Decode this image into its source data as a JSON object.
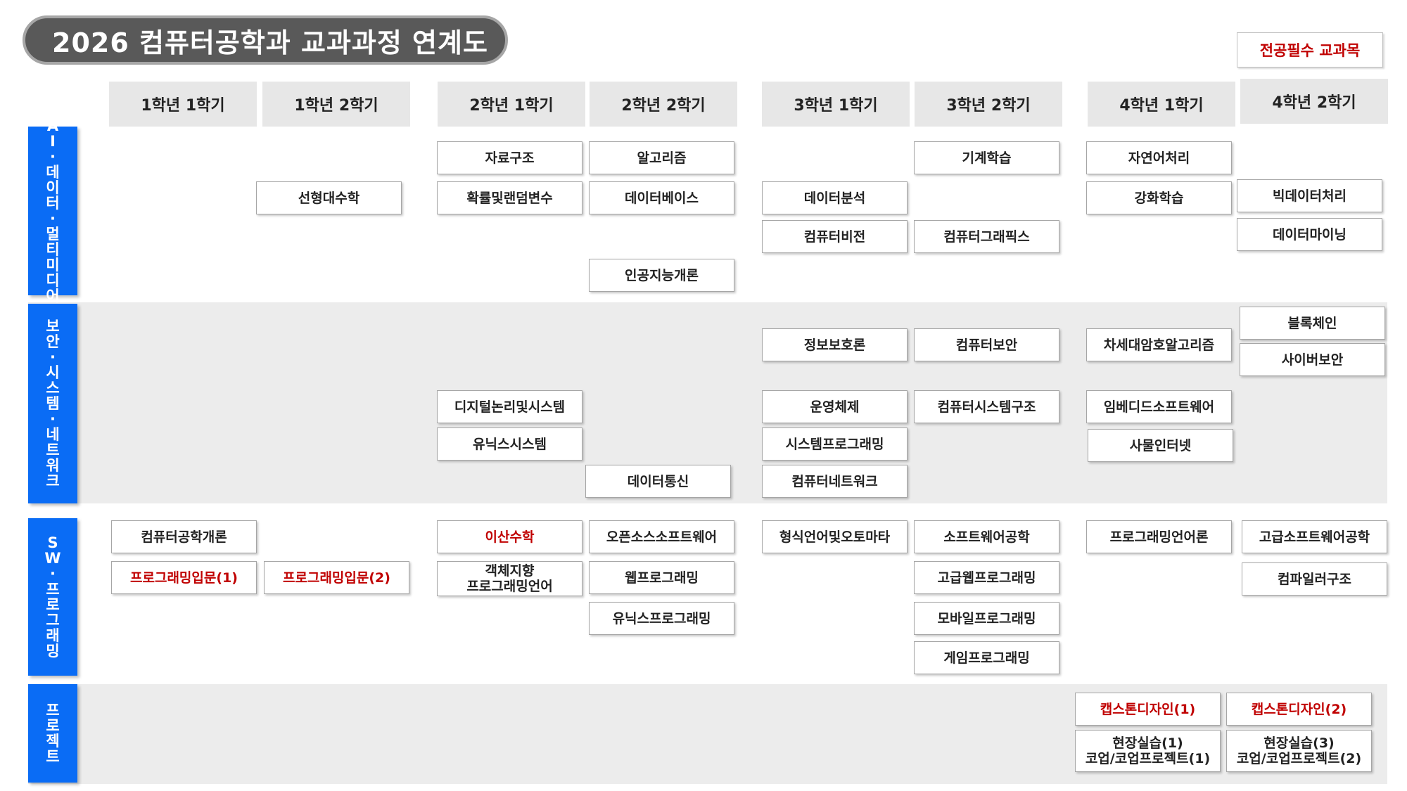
{
  "title": "2026 컴퓨터공학과 교과과정 연계도",
  "legend": "전공필수 교과목",
  "colors": {
    "required": "#c00000",
    "track": "#0a6cf5",
    "header": "#e7e7e7"
  },
  "semesters": [
    "1학년 1학기",
    "1학년 2학기",
    "2학년 1학기",
    "2학년 2학기",
    "3학년 1학기",
    "3학년 2학기",
    "4학년 1학기",
    "4학년 2학기"
  ],
  "tracks": [
    {
      "label": "AI·데이터·멀티미디어",
      "chars": [
        "A",
        "I",
        "·",
        "데",
        "이",
        "터",
        "·",
        "멀",
        "티",
        "미",
        "디",
        "어"
      ]
    },
    {
      "label": "보안·시스템·네트워크",
      "chars": [
        "보",
        "안",
        "·",
        "시",
        "스",
        "템",
        "·",
        "네",
        "트",
        "워",
        "크"
      ]
    },
    {
      "label": "SW·프로그래밍",
      "chars": [
        "S",
        "W",
        "·",
        "프",
        "로",
        "그",
        "래",
        "밍"
      ]
    },
    {
      "label": "프로젝트",
      "chars": [
        "프",
        "로",
        "젝",
        "트"
      ]
    }
  ],
  "courses": {
    "c01": "자료구조",
    "c02": "알고리즘",
    "c03": "기계학습",
    "c04": "자연어처리",
    "c05": "선형대수학",
    "c06": "확률및랜덤변수",
    "c07": "데이터베이스",
    "c08": "데이터분석",
    "c09": "강화학습",
    "c10": "빅데이터처리",
    "c11": "컴퓨터비전",
    "c12": "컴퓨터그래픽스",
    "c13": "데이터마이닝",
    "c14": "인공지능개론",
    "c15": "블록체인",
    "c16": "정보보호론",
    "c17": "컴퓨터보안",
    "c18": "차세대암호알고리즘",
    "c19": "사이버보안",
    "c20": "디지털논리및시스템",
    "c21": "운영체제",
    "c22": "컴퓨터시스템구조",
    "c23": "임베디드소프트웨어",
    "c24": "유닉스시스템",
    "c25": "시스템프로그래밍",
    "c26": "사물인터넷",
    "c27": "데이터통신",
    "c28": "컴퓨터네트워크",
    "c29": "컴퓨터공학개론",
    "c30": "이산수학",
    "c31": "오픈소스소프트웨어",
    "c32": "형식언어및오토마타",
    "c33": "소프트웨어공학",
    "c34": "프로그래밍언어론",
    "c35": "고급소프트웨어공학",
    "c36": "프로그래밍입문(1)",
    "c37": "프로그래밍입문(2)",
    "c38": "객체지향\n프로그래밍언어",
    "c39": "웹프로그래밍",
    "c40": "고급웹프로그래밍",
    "c41": "컴파일러구조",
    "c42": "유닉스프로그래밍",
    "c43": "모바일프로그래밍",
    "c44": "게임프로그래밍",
    "c45": "캡스톤디자인(1)",
    "c46": "캡스톤디자인(2)",
    "c47": "현장실습(1)\n코업/코업프로젝트(1)",
    "c48": "현장실습(3)\n코업/코업프로젝트(2)"
  }
}
